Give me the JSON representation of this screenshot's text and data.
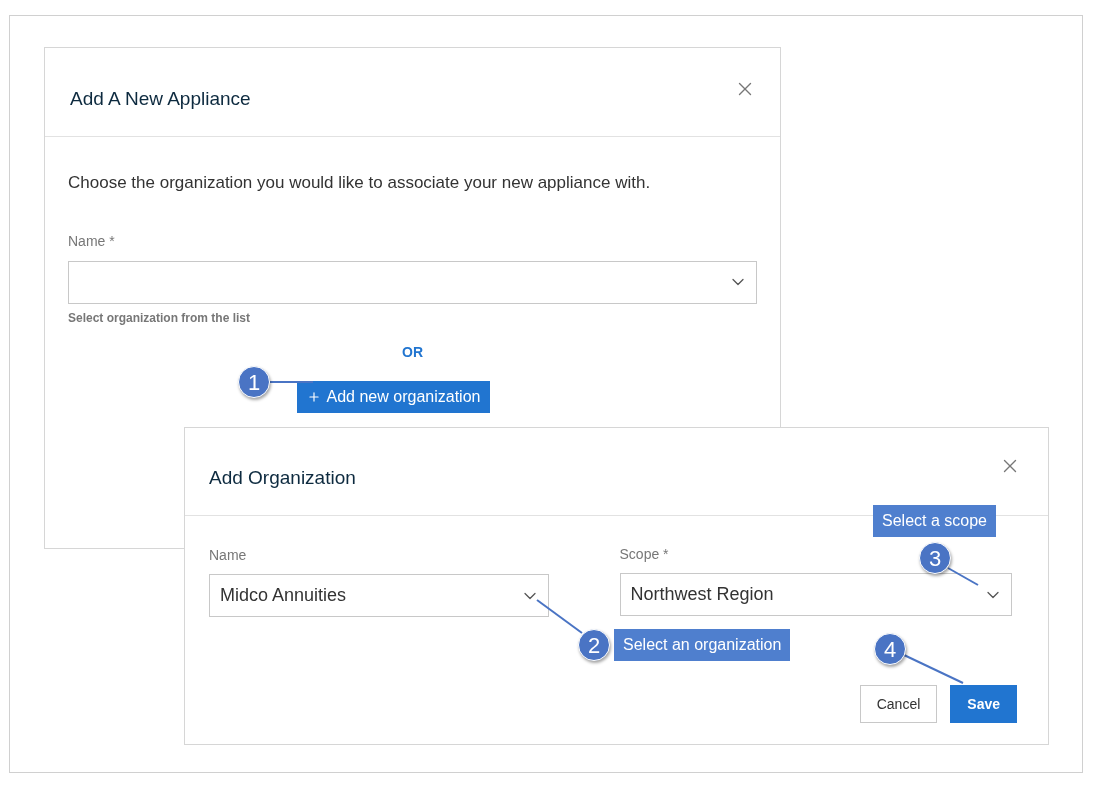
{
  "appliance_dialog": {
    "title": "Add A New Appliance",
    "intro": "Choose the organization you would like to associate your new appliance with.",
    "field": {
      "label": "Name *",
      "hint": "Select organization from the list"
    },
    "or_text": "OR",
    "add_button": "Add new organization"
  },
  "organization_dialog": {
    "title": "Add Organization",
    "fields": [
      {
        "label": "Name",
        "value": "Midco Annuities"
      },
      {
        "label": "Scope *",
        "value": "Northwest Region"
      }
    ],
    "buttons": [
      {
        "label": "Cancel",
        "kind": "secondary"
      },
      {
        "label": "Save",
        "kind": "primary"
      }
    ]
  },
  "annotations": [
    {
      "number": "1"
    },
    {
      "number": "2",
      "label": "Select an organization"
    },
    {
      "number": "3",
      "label": "Select a scope"
    },
    {
      "number": "4"
    }
  ]
}
